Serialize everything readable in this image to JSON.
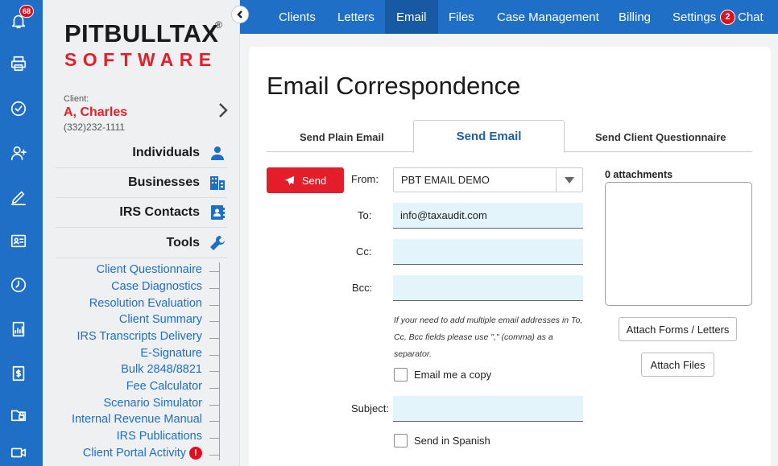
{
  "rail": {
    "notification_count": "68",
    "icons": [
      "bell-icon",
      "printer-icon",
      "check-circle-icon",
      "add-user-icon",
      "pencil-icon",
      "id-card-icon",
      "clock-icon",
      "report-icon",
      "invoice-icon",
      "lock-folder-icon",
      "video-icon"
    ]
  },
  "brand": {
    "logo_top": "PITBULLTAX",
    "logo_reg": "®",
    "logo_bottom": "SOFTWARE"
  },
  "client": {
    "label": "Client:",
    "name": "A, Charles",
    "phone": "(332)232-1111"
  },
  "sidebar": {
    "sections": [
      {
        "label": "Individuals",
        "icon": "person-icon"
      },
      {
        "label": "Businesses",
        "icon": "building-icon"
      },
      {
        "label": "IRS Contacts",
        "icon": "contacts-book-icon"
      },
      {
        "label": "Tools",
        "icon": "wrench-icon"
      }
    ],
    "tools": [
      "Client Questionnaire",
      "Case Diagnostics",
      "Resolution Evaluation",
      "Client Summary",
      "IRS Transcripts Delivery",
      "E-Signature",
      "Bulk 2848/8821",
      "Fee Calculator",
      "Scenario Simulator",
      "Internal Revenue Manual",
      "IRS Publications",
      "Client Portal Activity"
    ],
    "portal_alert": "!"
  },
  "nav": {
    "items": [
      "Clients",
      "Letters",
      "Email",
      "Files",
      "Case Management",
      "Billing",
      "Settings"
    ],
    "active": "Email",
    "chat_label": "Chat",
    "chat_count": "2"
  },
  "page": {
    "title": "Email Correspondence",
    "tabs": [
      "Send Plain Email",
      "Send Email",
      "Send Client Questionnaire"
    ],
    "active_tab": "Send Email"
  },
  "form": {
    "send_label": "Send",
    "from_label": "From:",
    "from_value": "PBT EMAIL DEMO",
    "to_label": "To:",
    "to_value": "info@taxaudit.com",
    "cc_label": "Cc:",
    "cc_value": "",
    "bcc_label": "Bcc:",
    "bcc_value": "",
    "hint": "If your need to add multiple email addresses in To, Cc, Bcc fields please use \",\" (comma) as a separator.",
    "email_copy_label": "Email me a copy",
    "subject_label": "Subject:",
    "subject_value": "",
    "spanish_label": "Send in Spanish"
  },
  "attachments": {
    "count_label": "0 attachments",
    "attach_forms_label": "Attach Forms / Letters",
    "attach_files_label": "Attach Files"
  },
  "colors": {
    "brand_blue": "#1f6fc7",
    "brand_red": "#e3202a",
    "field_bg": "#e3f4fb"
  }
}
